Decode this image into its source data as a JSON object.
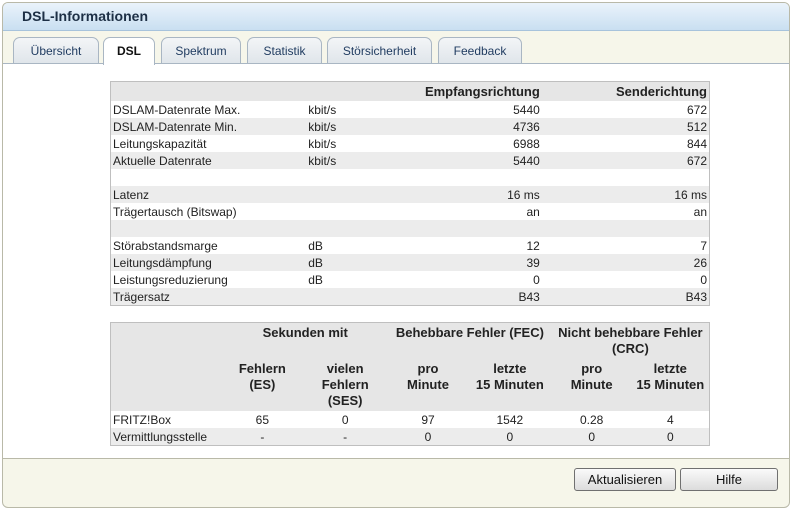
{
  "window": {
    "title": "DSL-Informationen"
  },
  "tabs": [
    {
      "label": "Übersicht",
      "active": false
    },
    {
      "label": "DSL",
      "active": true
    },
    {
      "label": "Spektrum",
      "active": false
    },
    {
      "label": "Statistik",
      "active": false
    },
    {
      "label": "Störsicherheit",
      "active": false
    },
    {
      "label": "Feedback",
      "active": false
    }
  ],
  "info_table": {
    "headers": [
      "",
      "",
      "Empfangsrichtung",
      "Senderichtung"
    ],
    "rows": [
      [
        "DSLAM-Datenrate Max.",
        "kbit/s",
        "5440",
        "672"
      ],
      [
        "DSLAM-Datenrate Min.",
        "kbit/s",
        "4736",
        "512"
      ],
      [
        "Leitungskapazität",
        "kbit/s",
        "6988",
        "844"
      ],
      [
        "Aktuelle Datenrate",
        "kbit/s",
        "5440",
        "672"
      ],
      [
        "",
        "",
        "",
        ""
      ],
      [
        "Latenz",
        "",
        "16 ms",
        "16 ms"
      ],
      [
        "Trägertausch (Bitswap)",
        "",
        "an",
        "an"
      ],
      [
        "",
        "",
        "",
        ""
      ],
      [
        "Störabstandsmarge",
        "dB",
        "12",
        "7"
      ],
      [
        "Leitungsdämpfung",
        "dB",
        "39",
        "26"
      ],
      [
        "Leistungsreduzierung",
        "dB",
        "0",
        "0"
      ],
      [
        "Trägersatz",
        "",
        "B43",
        "B43"
      ]
    ]
  },
  "error_table": {
    "group_headers": [
      "Sekunden mit",
      "Behebbare Fehler (FEC)",
      "Nicht behebbare Fehler (CRC)"
    ],
    "sub_headers": [
      [
        "Fehlern",
        "(ES)"
      ],
      [
        "vielen",
        "Fehlern",
        "(SES)"
      ],
      [
        "pro",
        "Minute"
      ],
      [
        "letzte",
        "15 Minuten"
      ],
      [
        "pro",
        "Minute"
      ],
      [
        "letzte",
        "15 Minuten"
      ]
    ],
    "rows": [
      [
        "FRITZ!Box",
        "65",
        "0",
        "97",
        "1542",
        "0.28",
        "4"
      ],
      [
        "Vermittlungsstelle",
        "-",
        "-",
        "0",
        "0",
        "0",
        "0"
      ]
    ]
  },
  "buttons": {
    "refresh": "Aktualisieren",
    "help": "Hilfe"
  }
}
